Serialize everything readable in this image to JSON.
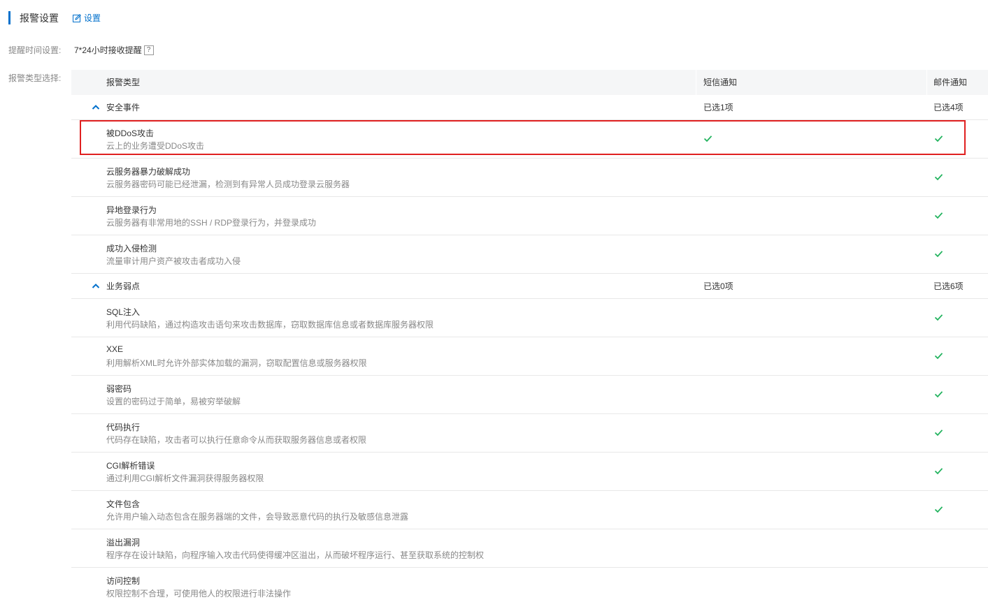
{
  "header": {
    "title": "报警设置",
    "edit_label": "设置"
  },
  "time_setting": {
    "label": "提醒时间设置:",
    "value": "7*24小时接收提醒",
    "help": "?"
  },
  "type_select": {
    "label": "报警类型选择:"
  },
  "table": {
    "columns": [
      "报警类型",
      "短信通知",
      "邮件通知"
    ],
    "groups": [
      {
        "name": "安全事件",
        "sms_summary": "已选1项",
        "mail_summary": "已选4项",
        "items": [
          {
            "name": "被DDoS攻击",
            "desc": "云上的业务遭受DDoS攻击",
            "sms": true,
            "mail": true
          },
          {
            "name": "云服务器暴力破解成功",
            "desc": "云服务器密码可能已经泄漏，检测到有异常人员成功登录云服务器",
            "sms": false,
            "mail": true
          },
          {
            "name": "异地登录行为",
            "desc": "云服务器有非常用地的SSH / RDP登录行为，并登录成功",
            "sms": false,
            "mail": true
          },
          {
            "name": "成功入侵检测",
            "desc": "流量审计用户资产被攻击者成功入侵",
            "sms": false,
            "mail": true
          }
        ]
      },
      {
        "name": "业务弱点",
        "sms_summary": "已选0项",
        "mail_summary": "已选6项",
        "items": [
          {
            "name": "SQL注入",
            "desc": "利用代码缺陷，通过构造攻击语句来攻击数据库，窃取数据库信息或者数据库服务器权限",
            "sms": false,
            "mail": true
          },
          {
            "name": "XXE",
            "desc": "利用解析XML时允许外部实体加载的漏洞，窃取配置信息或服务器权限",
            "sms": false,
            "mail": true
          },
          {
            "name": "弱密码",
            "desc": "设置的密码过于简单，易被穷举破解",
            "sms": false,
            "mail": true
          },
          {
            "name": "代码执行",
            "desc": "代码存在缺陷，攻击者可以执行任意命令从而获取服务器信息或者权限",
            "sms": false,
            "mail": true
          },
          {
            "name": "CGI解析错误",
            "desc": "通过利用CGI解析文件漏洞获得服务器权限",
            "sms": false,
            "mail": true
          },
          {
            "name": "文件包含",
            "desc": "允许用户输入动态包含在服务器端的文件，会导致恶意代码的执行及敏感信息泄露",
            "sms": false,
            "mail": true
          },
          {
            "name": "溢出漏洞",
            "desc": "程序存在设计缺陷，向程序输入攻击代码使得缓冲区溢出，从而破坏程序运行、甚至获取系统的控制权",
            "sms": false,
            "mail": false
          },
          {
            "name": "访问控制",
            "desc": "权限控制不合理，可使用他人的权限进行非法操作",
            "sms": false,
            "mail": false
          }
        ]
      }
    ]
  },
  "colors": {
    "accent": "#0070cc",
    "check": "#22b35e",
    "highlight": "#e02020"
  }
}
